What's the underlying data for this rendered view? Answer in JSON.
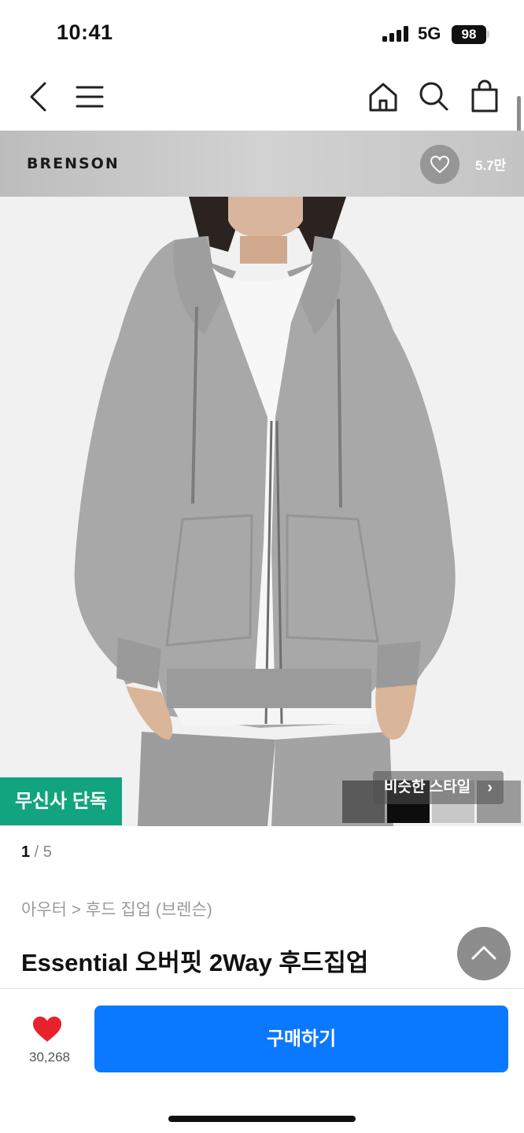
{
  "status_bar": {
    "time": "10:41",
    "network": "5G",
    "battery": "98"
  },
  "nav": {
    "icons": [
      "back-icon",
      "menu-icon",
      "home-icon",
      "search-icon",
      "shopping-bag-icon"
    ]
  },
  "brand": {
    "name": "BRENSON",
    "favorite_count": "5.7만"
  },
  "product_image": {
    "exclusive_badge": "무신사 단독",
    "similar_styles_label": "비슷한 스타일",
    "thumb_colors": [
      "#5a5a5a",
      "#0d0d0d",
      "#c8c8c8",
      "#9a9a9a"
    ]
  },
  "pager": {
    "current": "1",
    "separator": " / ",
    "total": "5"
  },
  "breadcrumb": "아우터 > 후드 집업 (브렌슨)",
  "product": {
    "title": "Essential 오버핏 2Way 후드집업"
  },
  "bottom_bar": {
    "like_count": "30,268",
    "buy_label": "구매하기"
  },
  "colors": {
    "accent_blue": "#0a78ff",
    "exclusive_green": "#12a47e",
    "heart_red": "#e8212b"
  }
}
